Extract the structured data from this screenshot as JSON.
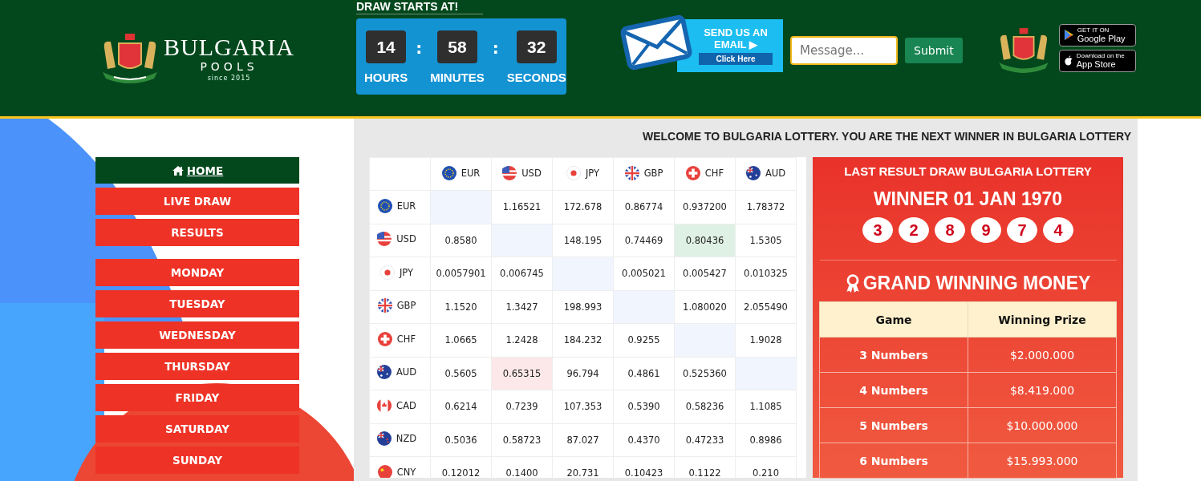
{
  "header": {
    "logo": {
      "name": "BULGARIA",
      "sub": "POOLS",
      "since": "since 2015"
    },
    "countdown": {
      "title": "DRAW STARTS AT!",
      "units": [
        {
          "value": "14",
          "label": "HOURS"
        },
        {
          "value": "58",
          "label": "MINUTES"
        },
        {
          "value": "32",
          "label": "SECONDS"
        }
      ],
      "separator": ":"
    },
    "email_banner": {
      "title": "SEND US AN EMAIL",
      "arrow": "▶",
      "button": "Click Here"
    },
    "message": {
      "placeholder": "Message..."
    },
    "submit": "Submit",
    "badges": [
      {
        "small": "GET IT ON",
        "big": "Google Play"
      },
      {
        "small": "Download on the",
        "big": "App Store"
      }
    ]
  },
  "sidebar": {
    "menu": [
      {
        "label": "HOME",
        "selected": true
      },
      {
        "label": "LIVE DRAW",
        "selected": false
      },
      {
        "label": "RESULTS",
        "selected": false
      }
    ],
    "days": [
      {
        "label": "MONDAY",
        "selected": false
      },
      {
        "label": "TUESDAY",
        "selected": false
      },
      {
        "label": "WEDNESDAY",
        "selected": false
      },
      {
        "label": "THURSDAY",
        "selected": false
      },
      {
        "label": "FRIDAY",
        "selected": false
      },
      {
        "label": "SATURDAY",
        "selected": false
      },
      {
        "label": "SUNDAY",
        "selected": false
      }
    ]
  },
  "marquee": "WELCOME TO BULGARIA LOTTERY. YOU ARE THE NEXT WINNER IN BULGARIA LOTTERY",
  "rates": {
    "columns": [
      "EUR",
      "USD",
      "JPY",
      "GBP",
      "CHF",
      "AUD"
    ],
    "rows": [
      {
        "currency": "EUR",
        "cells": [
          {
            "kind": "self"
          },
          {
            "kind": "rate",
            "value": "1.16521"
          },
          {
            "kind": "rate",
            "value": "172.678"
          },
          {
            "kind": "rate",
            "value": "0.86774"
          },
          {
            "kind": "rate",
            "value": "0.937200"
          },
          {
            "kind": "rate",
            "value": "1.78372"
          }
        ]
      },
      {
        "currency": "USD",
        "cells": [
          {
            "kind": "rate",
            "value": "0.8580"
          },
          {
            "kind": "self"
          },
          {
            "kind": "rate",
            "value": "148.195"
          },
          {
            "kind": "rate",
            "value": "0.74469"
          },
          {
            "kind": "up",
            "value": "0.80436"
          },
          {
            "kind": "rate",
            "value": "1.5305"
          }
        ]
      },
      {
        "currency": "JPY",
        "cells": [
          {
            "kind": "rate",
            "value": "0.0057901"
          },
          {
            "kind": "rate",
            "value": "0.006745"
          },
          {
            "kind": "self"
          },
          {
            "kind": "rate",
            "value": "0.005021"
          },
          {
            "kind": "rate",
            "value": "0.005427"
          },
          {
            "kind": "rate",
            "value": "0.010325"
          }
        ]
      },
      {
        "currency": "GBP",
        "cells": [
          {
            "kind": "rate",
            "value": "1.1520"
          },
          {
            "kind": "rate",
            "value": "1.3427"
          },
          {
            "kind": "rate",
            "value": "198.993"
          },
          {
            "kind": "self"
          },
          {
            "kind": "rate",
            "value": "1.080020"
          },
          {
            "kind": "rate",
            "value": "2.055490"
          }
        ]
      },
      {
        "currency": "CHF",
        "cells": [
          {
            "kind": "rate",
            "value": "1.0665"
          },
          {
            "kind": "rate",
            "value": "1.2428"
          },
          {
            "kind": "rate",
            "value": "184.232"
          },
          {
            "kind": "rate",
            "value": "0.9255"
          },
          {
            "kind": "self"
          },
          {
            "kind": "rate",
            "value": "1.9028"
          }
        ]
      },
      {
        "currency": "AUD",
        "cells": [
          {
            "kind": "rate",
            "value": "0.5605"
          },
          {
            "kind": "down",
            "value": "0.65315"
          },
          {
            "kind": "rate",
            "value": "96.794"
          },
          {
            "kind": "rate",
            "value": "0.4861"
          },
          {
            "kind": "rate",
            "value": "0.525360"
          },
          {
            "kind": "self"
          }
        ]
      },
      {
        "currency": "CAD",
        "cells": [
          {
            "kind": "rate",
            "value": "0.6214"
          },
          {
            "kind": "rate",
            "value": "0.7239"
          },
          {
            "kind": "rate",
            "value": "107.353"
          },
          {
            "kind": "rate",
            "value": "0.5390"
          },
          {
            "kind": "rate",
            "value": "0.58236"
          },
          {
            "kind": "rate",
            "value": "1.1085"
          }
        ]
      },
      {
        "currency": "NZD",
        "cells": [
          {
            "kind": "rate",
            "value": "0.5036"
          },
          {
            "kind": "rate",
            "value": "0.58723"
          },
          {
            "kind": "rate",
            "value": "87.027"
          },
          {
            "kind": "rate",
            "value": "0.4370"
          },
          {
            "kind": "rate",
            "value": "0.47233"
          },
          {
            "kind": "rate",
            "value": "0.8986"
          }
        ]
      },
      {
        "currency": "CNY",
        "cells": [
          {
            "kind": "rate",
            "value": "0.12012"
          },
          {
            "kind": "rate",
            "value": "0.1400"
          },
          {
            "kind": "rate",
            "value": "20.731"
          },
          {
            "kind": "rate",
            "value": "0.10423"
          },
          {
            "kind": "rate",
            "value": "0.1122"
          },
          {
            "kind": "rate",
            "value": "0.210"
          }
        ]
      }
    ]
  },
  "result": {
    "title": "LAST RESULT DRAW BULGARIA LOTTERY",
    "winner": "WINNER 01 JAN 1970",
    "numbers": [
      "3",
      "2",
      "8",
      "9",
      "7",
      "4"
    ],
    "prize_title": "GRAND WINNING MONEY",
    "columns": [
      "Game",
      "Winning Prize"
    ],
    "rows": [
      {
        "game": "3 Numbers",
        "prize": "$2.000.000"
      },
      {
        "game": "4 Numbers",
        "prize": "$8.419.000"
      },
      {
        "game": "5 Numbers",
        "prize": "$10.000.000"
      },
      {
        "game": "6 Numbers",
        "prize": "$15.993.000"
      }
    ]
  }
}
